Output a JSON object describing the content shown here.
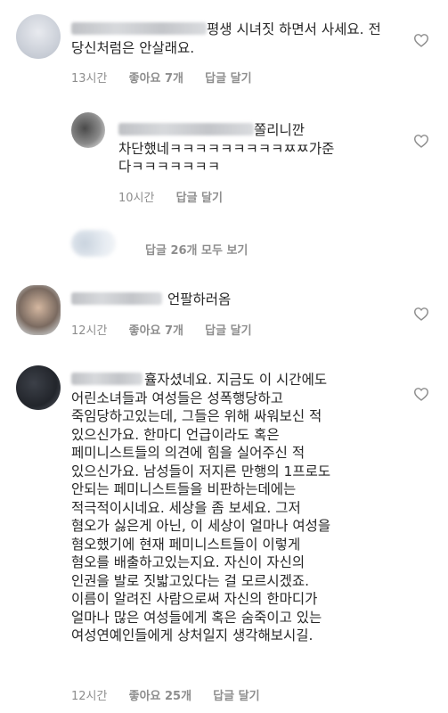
{
  "comments": [
    {
      "lines": [
        "평생 시녀짓 하면서 사세요. 전",
        "당신처럼은 안살래요."
      ],
      "time": "13시간",
      "likes": "좋아요 7개",
      "reply": "답글 달기"
    },
    {
      "lines": [
        "쫄리니깐",
        "차단했네ㅋㅋㅋㅋㅋㅋㅋㅋㅋㅉㅉ가준",
        "다ㅋㅋㅋㅋㅋㅋㅋ"
      ],
      "time": "10시간",
      "reply": "답글 달기"
    },
    {
      "lines": [
        "언팔하러옴"
      ],
      "time": "12시간",
      "likes": "좋아요 7개",
      "reply": "답글 달기"
    },
    {
      "lines": [
        "휼자셨네요. 지금도 이 시간에도",
        "어린소녀들과 여성들은 성폭행당하고",
        "죽임당하고있는데, 그들은 위해 싸워보신 적",
        "있으신가요. 한마디 언급이라도 혹은",
        "페미니스트들의 의견에 힘을 실어주신 적",
        "있으신가요. 남성들이 저지른 만행의 1프로도",
        "안되는 페미니스트들을 비판하는데에는",
        "적극적이시네요. 세상을 좀 보세요. 그저",
        "혐오가 싫은게 아닌, 이 세상이 얼마나 여성을",
        "혐오했기에 현재 페미니스트들이 이렇게",
        "혐오를 배출하고있는지요. 자신이 자신의",
        "인권을 발로 짓밟고있다는 걸 모르시겠죠.",
        "이름이 알려진 사람으로써 자신의 한마디가",
        "얼마나 많은 여성들에게 혹은 숨죽이고 있는",
        "여성연예인들에게 상처일지 생각해보시길."
      ],
      "time": "12시간",
      "likes": "좋아요 25개",
      "reply": "답글 달기"
    }
  ],
  "view_replies": "답글 26개 모두 보기",
  "colors": {
    "text": "#262626",
    "meta": "#8e8e8e",
    "heart": "#8e8e8e"
  },
  "icons": {
    "like": "heart-outline-icon"
  }
}
